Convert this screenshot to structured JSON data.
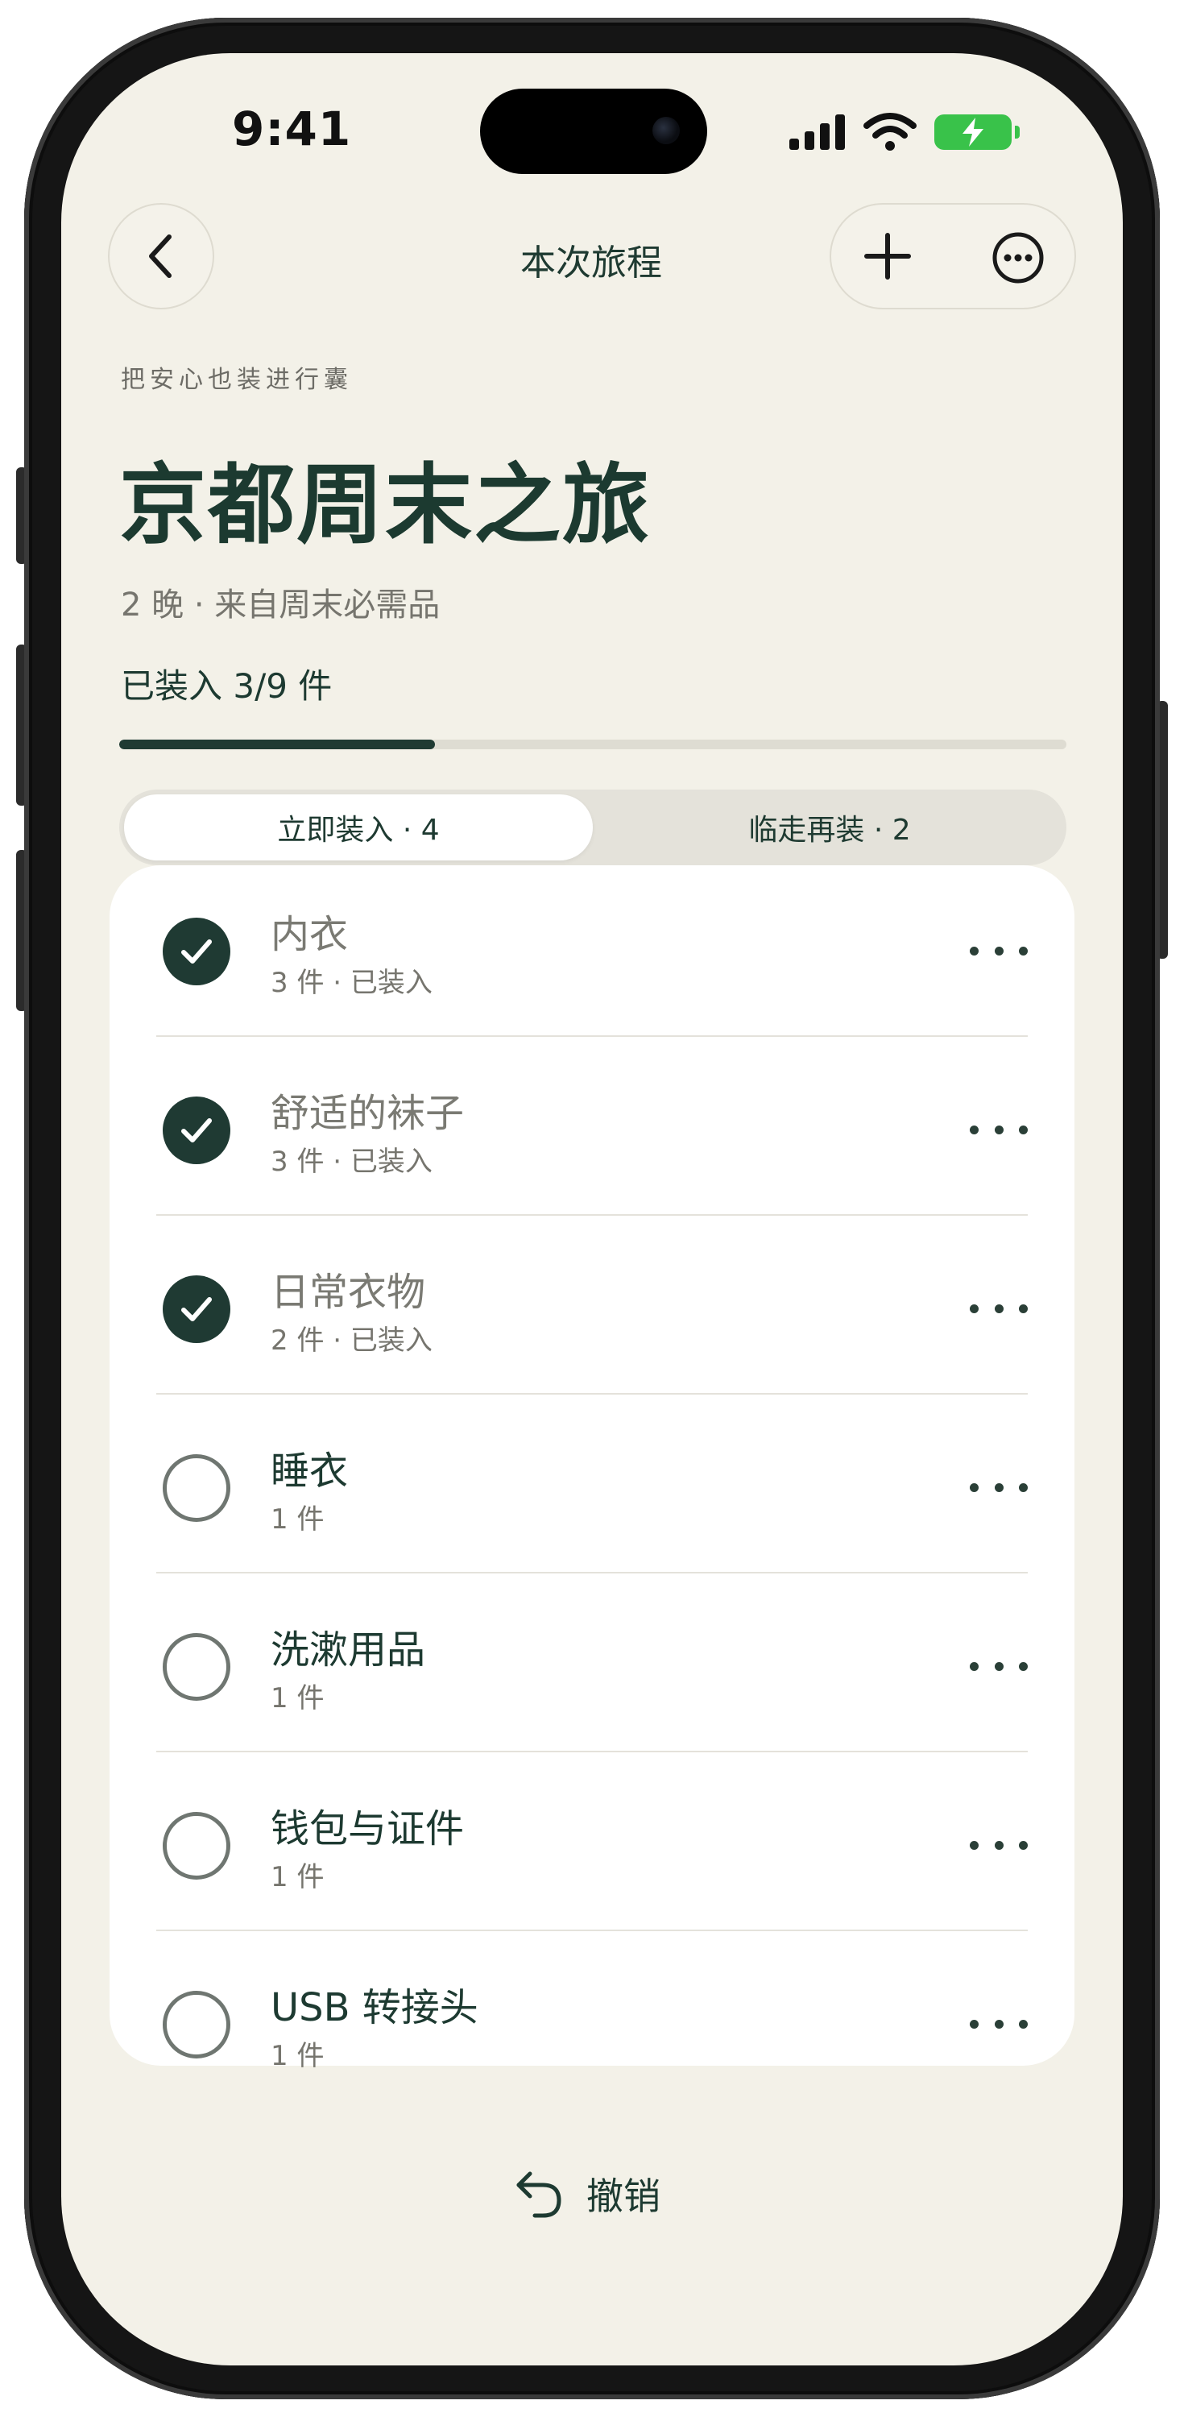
{
  "status_bar": {
    "time": "9:41"
  },
  "nav": {
    "title": "本次旅程"
  },
  "header": {
    "tagline": "把安心也装进行囊",
    "title": "京都周末之旅",
    "meta": "2 晚 · 来自周末必需品",
    "packed_label": "已装入 3/9 件",
    "progress": 0.333
  },
  "tabs": [
    {
      "label": "立即装入 · 4",
      "active": true
    },
    {
      "label": "临走再装 · 2",
      "active": false
    }
  ],
  "items": [
    {
      "name": "内衣",
      "detail": "3 件 · 已装入",
      "packed": true
    },
    {
      "name": "舒适的袜子",
      "detail": "3 件 · 已装入",
      "packed": true
    },
    {
      "name": "日常衣物",
      "detail": "2 件 · 已装入",
      "packed": true
    },
    {
      "name": "睡衣",
      "detail": "1 件",
      "packed": false
    },
    {
      "name": "洗漱用品",
      "detail": "1 件",
      "packed": false
    },
    {
      "name": "钱包与证件",
      "detail": "1 件",
      "packed": false
    },
    {
      "name": "USB 转接头",
      "detail": "1 件",
      "packed": false
    }
  ],
  "footer": {
    "undo_label": "撤销"
  },
  "colors": {
    "accent": "#1f3a33",
    "background": "#f3f1e8",
    "battery": "#39c24a"
  }
}
